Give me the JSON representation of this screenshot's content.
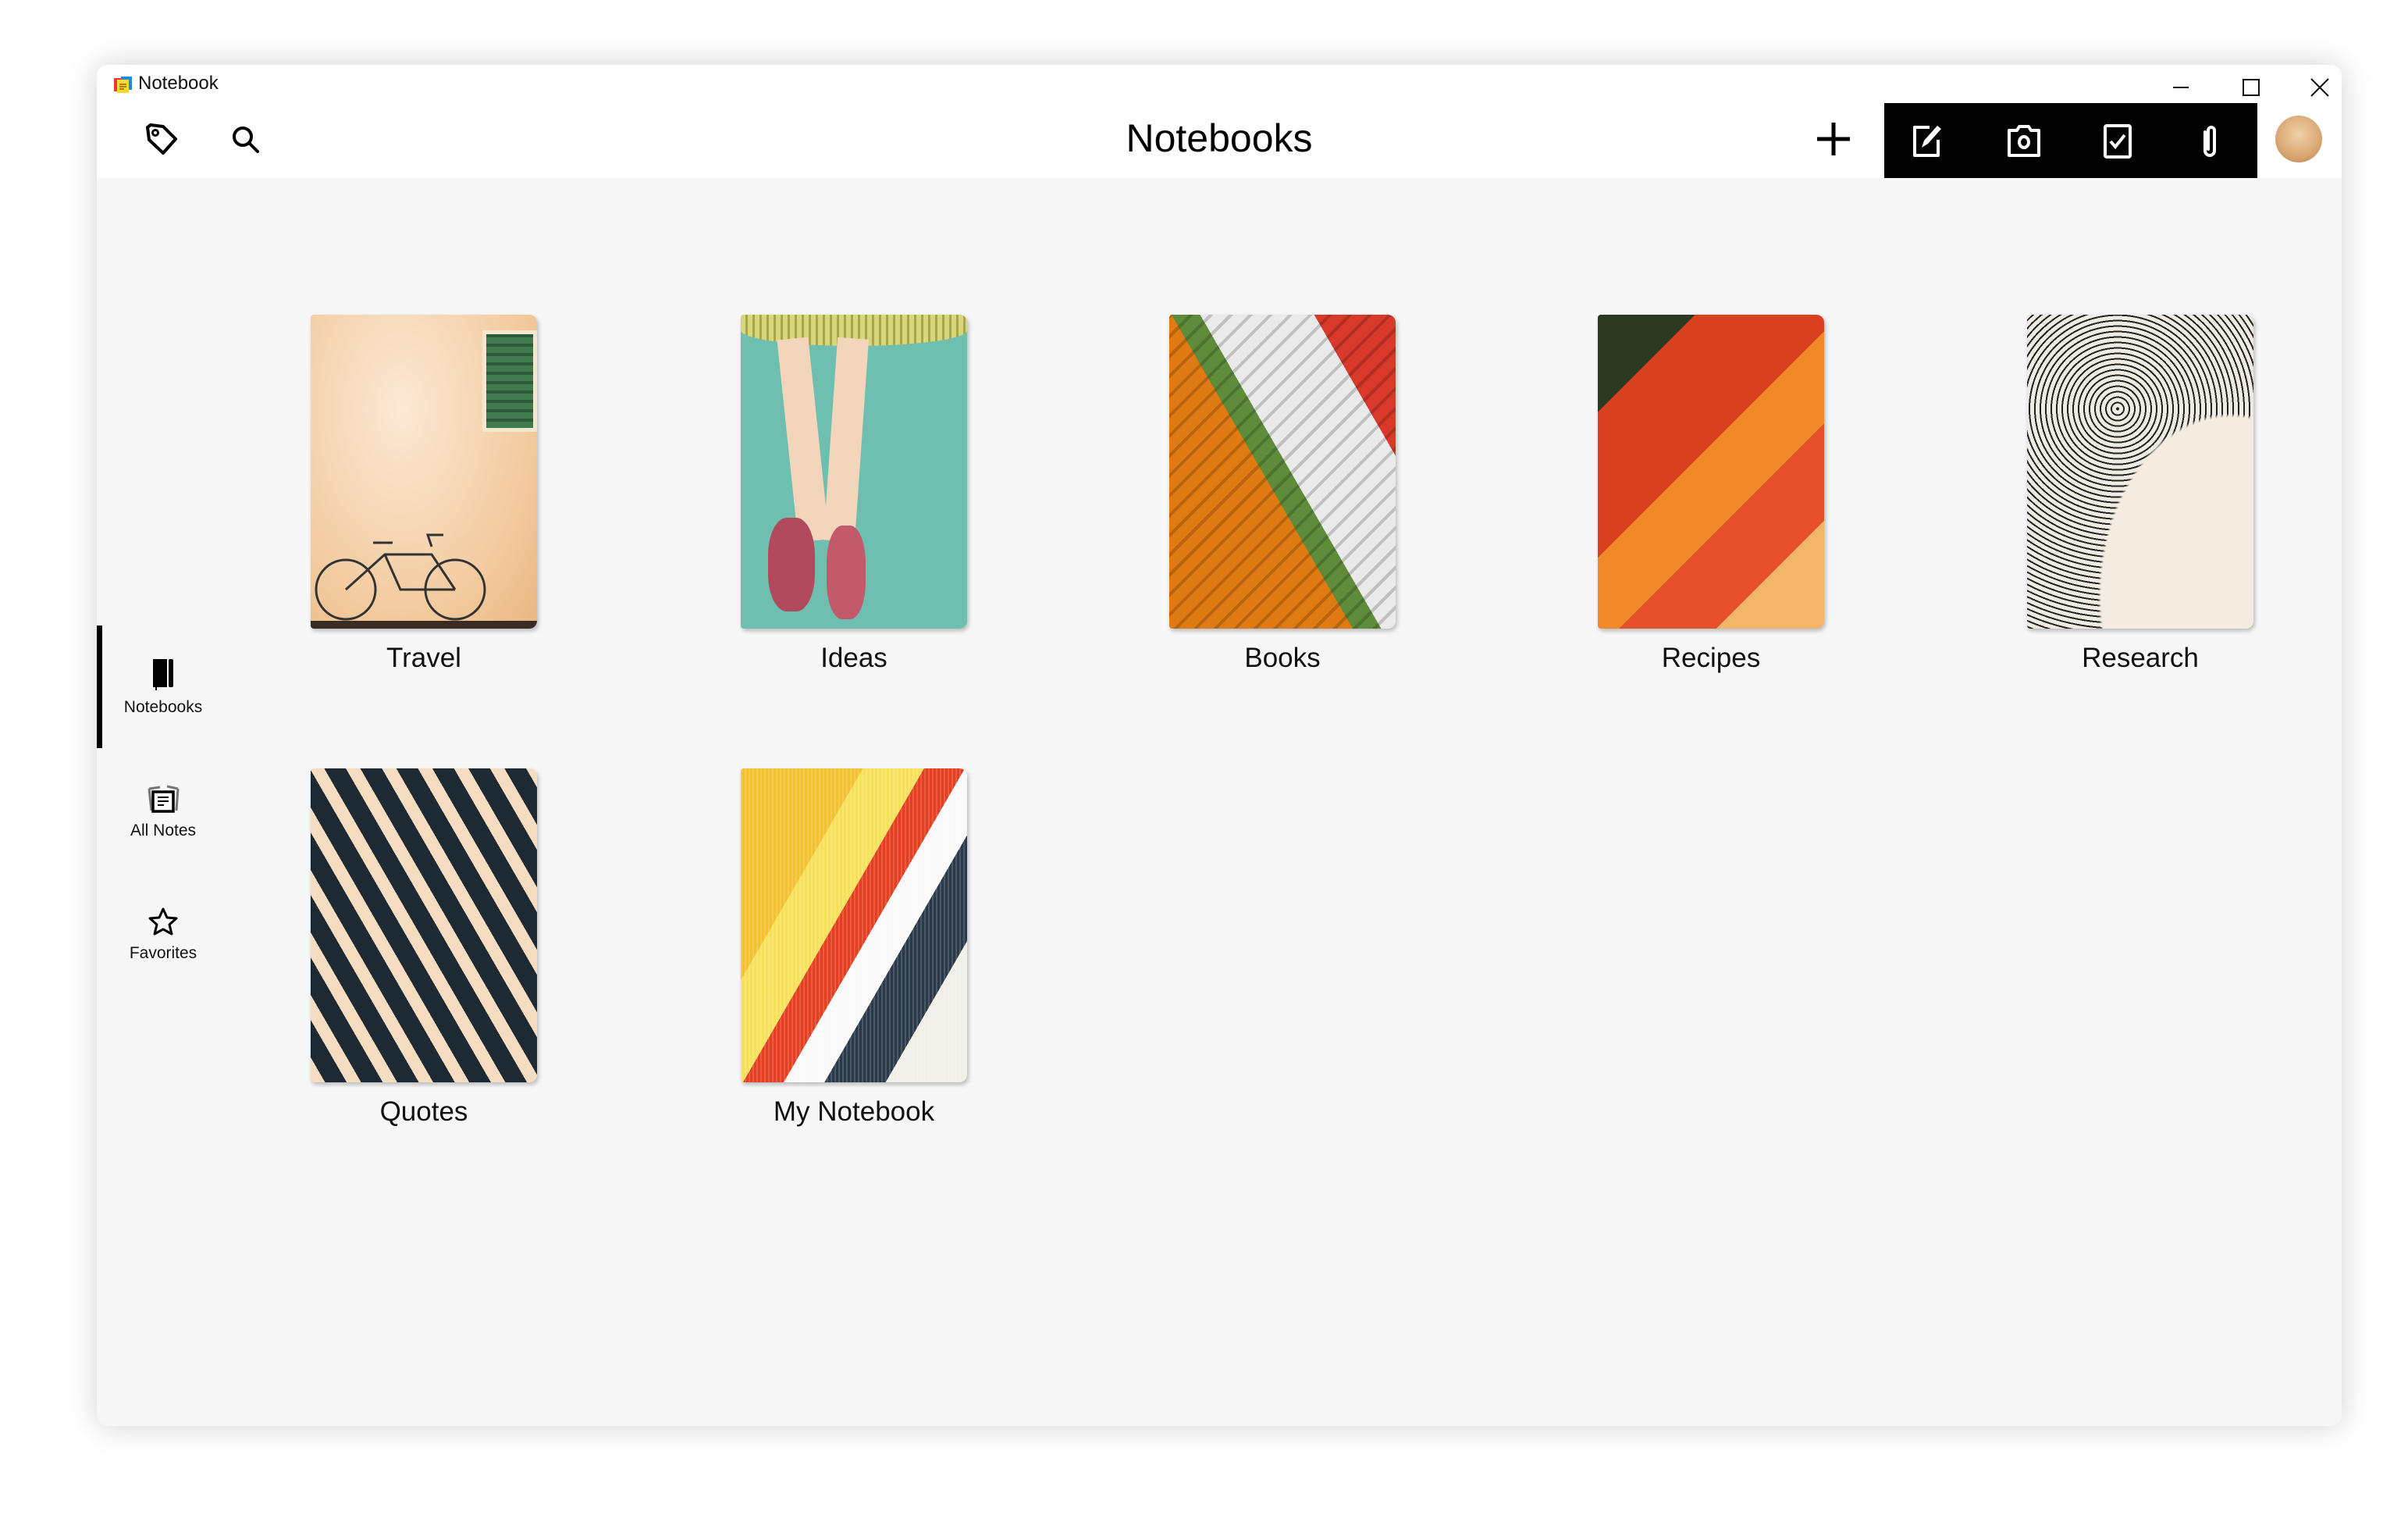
{
  "window": {
    "app_title": "Notebook",
    "controls": [
      "minimize",
      "maximize",
      "close"
    ]
  },
  "toolbar": {
    "title": "Notebooks",
    "left_icons": [
      "tag-icon",
      "search-icon"
    ],
    "add_icon": "plus-icon",
    "quick_actions": [
      "new-note-icon",
      "camera-icon",
      "checklist-icon",
      "attachment-icon"
    ],
    "accent": "#000000"
  },
  "sidebar": {
    "items": [
      {
        "label": "Notebooks",
        "icon": "notebook-icon",
        "selected": true
      },
      {
        "label": "All Notes",
        "icon": "all-notes-icon",
        "selected": false
      },
      {
        "label": "Favorites",
        "icon": "star-icon",
        "selected": false
      }
    ]
  },
  "notebooks": [
    {
      "name": "Travel"
    },
    {
      "name": "Ideas"
    },
    {
      "name": "Books"
    },
    {
      "name": "Recipes"
    },
    {
      "name": "Research"
    },
    {
      "name": "Quotes"
    },
    {
      "name": "My Notebook"
    }
  ]
}
